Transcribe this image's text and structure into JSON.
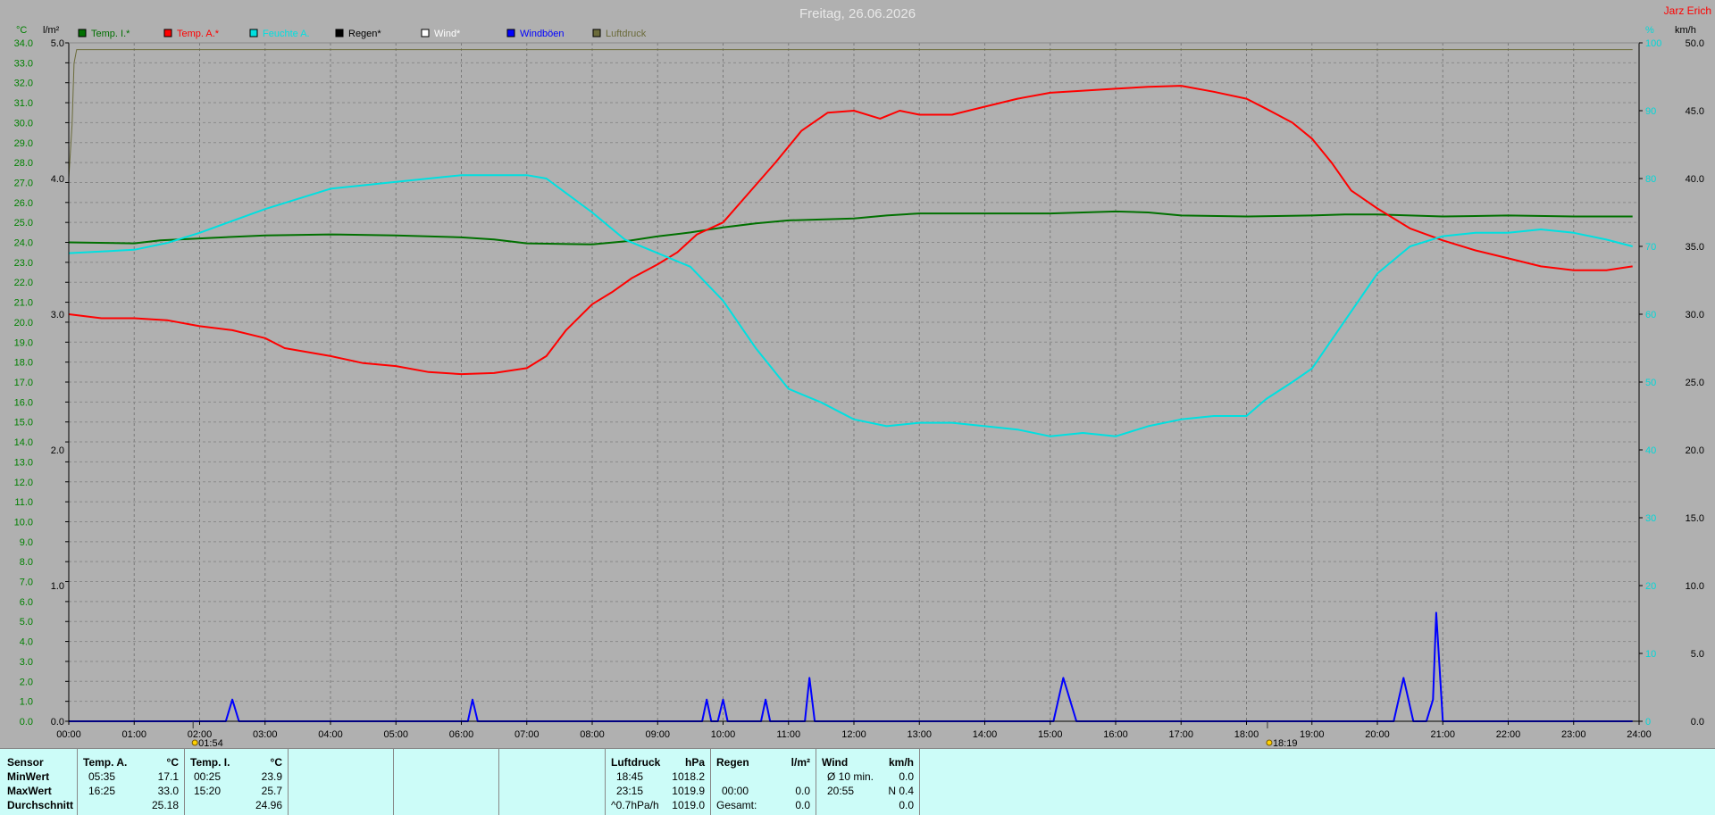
{
  "header": {
    "title": "Freitag, 26.06.2026",
    "station": "Jarz Erich"
  },
  "colors": {
    "temp_in": "#007000",
    "temp_out": "#ff0000",
    "humidity": "#00e0e0",
    "rain": "#000000",
    "wind": "#ffffff",
    "gusts": "#0000ff",
    "pressure": "#6b6b3a",
    "bg": "#b0b0b0",
    "axis_left": "#008000",
    "axis_right": "#00d8d8"
  },
  "axes": {
    "left_unit": "°C",
    "rain_unit": "l/m²",
    "right_top_unit": "%",
    "right_unit": "km/h",
    "temp_ticks": [
      "0.0",
      "1.0",
      "2.0",
      "3.0",
      "4.0",
      "5.0",
      "6.0",
      "7.0",
      "8.0",
      "9.0",
      "10.0",
      "11.0",
      "12.0",
      "13.0",
      "14.0",
      "15.0",
      "16.0",
      "17.0",
      "18.0",
      "19.0",
      "20.0",
      "21.0",
      "22.0",
      "23.0",
      "24.0",
      "25.0",
      "26.0",
      "27.0",
      "28.0",
      "29.0",
      "30.0",
      "31.0",
      "32.0",
      "33.0",
      "34.0"
    ],
    "rain_ticks": [
      "0.0",
      "1.0",
      "2.0",
      "3.0",
      "4.0",
      "5.0"
    ],
    "wind_ticks": [
      "0.0",
      "5.0",
      "10.0",
      "15.0",
      "20.0",
      "25.0",
      "30.0",
      "35.0",
      "40.0",
      "45.0",
      "50.0"
    ],
    "hum_ticks": [
      "0",
      "10",
      "20",
      "30",
      "40",
      "50",
      "60",
      "70",
      "80",
      "90",
      "100"
    ],
    "time_ticks": [
      "00:00",
      "01:00",
      "02:00",
      "03:00",
      "04:00",
      "05:00",
      "06:00",
      "07:00",
      "08:00",
      "09:00",
      "10:00",
      "11:00",
      "12:00",
      "13:00",
      "14:00",
      "15:00",
      "16:00",
      "17:00",
      "18:00",
      "19:00",
      "20:00",
      "21:00",
      "22:00",
      "23:00",
      "24:00"
    ],
    "markers": [
      {
        "time": 1.9,
        "label": "01:54"
      },
      {
        "time": 18.32,
        "label": "18:19"
      }
    ]
  },
  "chart_data": {
    "type": "line",
    "x_unit": "hours",
    "series": [
      {
        "name": "Temp. I.*",
        "key": "temp_in",
        "axis": "temp",
        "points": [
          [
            0,
            24.0
          ],
          [
            1,
            23.95
          ],
          [
            1.4,
            24.1
          ],
          [
            2,
            24.2
          ],
          [
            3,
            24.35
          ],
          [
            4,
            24.4
          ],
          [
            5,
            24.35
          ],
          [
            6,
            24.25
          ],
          [
            6.5,
            24.15
          ],
          [
            7,
            23.95
          ],
          [
            8,
            23.9
          ],
          [
            8.5,
            24.05
          ],
          [
            9,
            24.3
          ],
          [
            9.5,
            24.5
          ],
          [
            10,
            24.75
          ],
          [
            10.5,
            24.95
          ],
          [
            11,
            25.1
          ],
          [
            12,
            25.2
          ],
          [
            12.5,
            25.35
          ],
          [
            13,
            25.45
          ],
          [
            14,
            25.45
          ],
          [
            15,
            25.45
          ],
          [
            15.5,
            25.5
          ],
          [
            16,
            25.55
          ],
          [
            16.5,
            25.5
          ],
          [
            17,
            25.35
          ],
          [
            18,
            25.3
          ],
          [
            19,
            25.35
          ],
          [
            19.5,
            25.4
          ],
          [
            20,
            25.4
          ],
          [
            20.5,
            25.35
          ],
          [
            21,
            25.3
          ],
          [
            22,
            25.35
          ],
          [
            23,
            25.3
          ],
          [
            23.9,
            25.3
          ]
        ]
      },
      {
        "name": "Temp. A.*",
        "key": "temp_out",
        "axis": "temp",
        "points": [
          [
            0,
            20.4
          ],
          [
            0.5,
            20.2
          ],
          [
            1,
            20.2
          ],
          [
            1.5,
            20.1
          ],
          [
            2,
            19.8
          ],
          [
            2.5,
            19.6
          ],
          [
            3,
            19.2
          ],
          [
            3.3,
            18.7
          ],
          [
            4,
            18.3
          ],
          [
            4.5,
            17.95
          ],
          [
            5,
            17.8
          ],
          [
            5.5,
            17.5
          ],
          [
            6,
            17.4
          ],
          [
            6.5,
            17.45
          ],
          [
            7,
            17.7
          ],
          [
            7.3,
            18.3
          ],
          [
            7.6,
            19.6
          ],
          [
            8,
            20.9
          ],
          [
            8.3,
            21.5
          ],
          [
            8.6,
            22.2
          ],
          [
            9,
            22.9
          ],
          [
            9.3,
            23.5
          ],
          [
            9.6,
            24.4
          ],
          [
            10,
            25.0
          ],
          [
            10.4,
            26.5
          ],
          [
            10.8,
            28.0
          ],
          [
            11.2,
            29.6
          ],
          [
            11.6,
            30.5
          ],
          [
            12,
            30.6
          ],
          [
            12.4,
            30.2
          ],
          [
            12.7,
            30.6
          ],
          [
            13,
            30.4
          ],
          [
            13.5,
            30.4
          ],
          [
            14,
            30.8
          ],
          [
            14.5,
            31.2
          ],
          [
            15,
            31.5
          ],
          [
            15.5,
            31.6
          ],
          [
            16,
            31.7
          ],
          [
            16.5,
            31.8
          ],
          [
            17,
            31.85
          ],
          [
            17.5,
            31.55
          ],
          [
            18,
            31.2
          ],
          [
            18.3,
            30.7
          ],
          [
            18.7,
            30.0
          ],
          [
            19,
            29.2
          ],
          [
            19.3,
            28.0
          ],
          [
            19.6,
            26.6
          ],
          [
            20,
            25.7
          ],
          [
            20.5,
            24.7
          ],
          [
            21,
            24.1
          ],
          [
            21.5,
            23.6
          ],
          [
            22,
            23.2
          ],
          [
            22.5,
            22.8
          ],
          [
            23,
            22.6
          ],
          [
            23.5,
            22.6
          ],
          [
            23.9,
            22.8
          ]
        ]
      },
      {
        "name": "Feuchte A.",
        "key": "humidity",
        "axis": "hum",
        "points": [
          [
            0,
            69
          ],
          [
            1,
            69.5
          ],
          [
            1.5,
            70.5
          ],
          [
            2,
            72
          ],
          [
            3,
            75.5
          ],
          [
            4,
            78.5
          ],
          [
            5,
            79.5
          ],
          [
            6,
            80.5
          ],
          [
            6.5,
            80.5
          ],
          [
            7,
            80.5
          ],
          [
            7.3,
            80
          ],
          [
            8,
            75
          ],
          [
            8.5,
            71
          ],
          [
            9,
            69
          ],
          [
            9.5,
            67
          ],
          [
            10,
            62
          ],
          [
            10.5,
            55
          ],
          [
            11,
            49
          ],
          [
            11.5,
            47
          ],
          [
            12,
            44.5
          ],
          [
            12.5,
            43.5
          ],
          [
            13,
            44
          ],
          [
            13.5,
            44
          ],
          [
            14,
            43.5
          ],
          [
            14.5,
            43
          ],
          [
            15,
            42
          ],
          [
            15.5,
            42.5
          ],
          [
            16,
            42
          ],
          [
            16.5,
            43.5
          ],
          [
            17,
            44.5
          ],
          [
            17.5,
            45
          ],
          [
            18,
            45
          ],
          [
            18.3,
            47.5
          ],
          [
            18.7,
            50
          ],
          [
            19,
            52
          ],
          [
            19.5,
            59
          ],
          [
            20,
            66
          ],
          [
            20.5,
            70
          ],
          [
            21,
            71.5
          ],
          [
            21.5,
            72
          ],
          [
            22,
            72
          ],
          [
            22.5,
            72.5
          ],
          [
            23,
            72
          ],
          [
            23.5,
            71
          ],
          [
            23.9,
            70
          ]
        ]
      },
      {
        "name": "Windböen",
        "key": "gusts",
        "axis": "wind",
        "points": [
          [
            0,
            0
          ],
          [
            2.4,
            0
          ],
          [
            2.5,
            1.6
          ],
          [
            2.6,
            0
          ],
          [
            6.1,
            0
          ],
          [
            6.17,
            1.6
          ],
          [
            6.25,
            0
          ],
          [
            9.68,
            0
          ],
          [
            9.75,
            1.6
          ],
          [
            9.82,
            0
          ],
          [
            9.92,
            0
          ],
          [
            10.0,
            1.6
          ],
          [
            10.07,
            0
          ],
          [
            10.58,
            0
          ],
          [
            10.65,
            1.6
          ],
          [
            10.72,
            0
          ],
          [
            11.25,
            0
          ],
          [
            11.32,
            3.2
          ],
          [
            11.4,
            0
          ],
          [
            15.05,
            0
          ],
          [
            15.2,
            3.2
          ],
          [
            15.4,
            0
          ],
          [
            20.25,
            0
          ],
          [
            20.4,
            3.2
          ],
          [
            20.55,
            0
          ],
          [
            20.75,
            0
          ],
          [
            20.85,
            1.6
          ],
          [
            20.9,
            8.0
          ],
          [
            21.0,
            0
          ],
          [
            23.9,
            0
          ]
        ]
      },
      {
        "name": "Luftdruck",
        "key": "pressure",
        "axis": "press",
        "points": [
          [
            0,
            0.8
          ],
          [
            0.05,
            0.88
          ],
          [
            0.08,
            0.97
          ],
          [
            0.12,
            0.99
          ],
          [
            23.9,
            0.99
          ]
        ]
      }
    ],
    "legend": [
      {
        "label": "Temp. I.*",
        "color": "#007000"
      },
      {
        "label": "Temp. A.*",
        "color": "#ff0000"
      },
      {
        "label": "Feuchte A.",
        "color": "#00e0e0"
      },
      {
        "label": "Regen*",
        "color": "#000000"
      },
      {
        "label": "Wind*",
        "color": "#ffffff"
      },
      {
        "label": "Windböen",
        "color": "#0000ff"
      },
      {
        "label": "Luftdruck",
        "color": "#6b6b3a"
      }
    ],
    "ranges": {
      "temp": [
        0,
        34
      ],
      "rain": [
        0,
        5
      ],
      "wind": [
        0,
        50
      ],
      "hum": [
        0,
        100
      ],
      "time": [
        0,
        24
      ]
    },
    "grid": true
  },
  "summary": {
    "labels": [
      "Sensor",
      "MinWert",
      "MaxWert",
      "Durchschnitt"
    ],
    "temp_a": {
      "title": "Temp. A.",
      "unit": "°C",
      "min_time": "05:35",
      "min": "17.1",
      "max_time": "16:25",
      "max": "33.0",
      "avg": "25.18"
    },
    "temp_i": {
      "title": "Temp. I.",
      "unit": "°C",
      "min_time": "00:25",
      "min": "23.9",
      "max_time": "15:20",
      "max": "25.7",
      "avg": "24.96"
    },
    "pressure": {
      "title": "Luftdruck",
      "unit": "hPa",
      "min_time": "18:45",
      "min": "1018.2",
      "max_time": "23:15",
      "max": "1019.9",
      "trend": "^0.7hPa/h",
      "avg": "1019.0"
    },
    "rain": {
      "title": "Regen",
      "unit": "l/m²",
      "time": "00:00",
      "max": "0.0",
      "total_label": "Gesamt:",
      "total": "0.0"
    },
    "wind": {
      "title": "Wind",
      "unit": "km/h",
      "avg_label": "Ø 10 min.",
      "avg": "0.0",
      "max_time": "20:55",
      "max": "N 0.4",
      "mean": "0.0"
    }
  }
}
